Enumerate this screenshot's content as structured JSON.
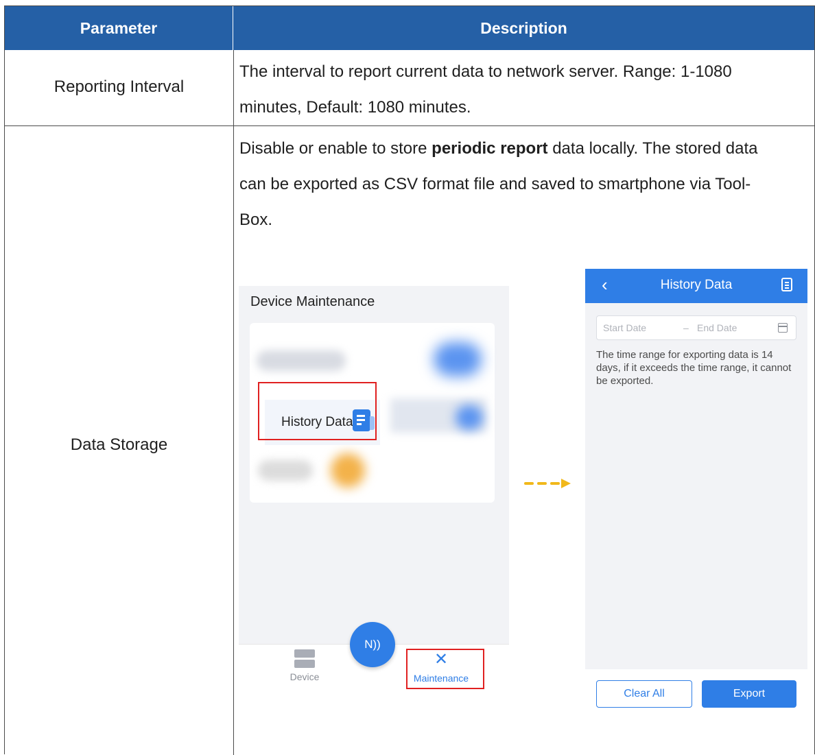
{
  "table": {
    "header": {
      "parameter": "Parameter",
      "description": "Description"
    },
    "rows": [
      {
        "parameter": "Reporting Interval",
        "description_line1": "The interval to report current data to network server. Range: 1-1080",
        "description_line2": "minutes, Default: 1080 minutes."
      },
      {
        "parameter": "Data Storage",
        "description_pre": "Disable or enable to store ",
        "description_bold": "periodic report",
        "description_post1": " data locally. The stored data",
        "description_line2": "can be exported as CSV format file and saved to smartphone via Tool-",
        "description_line3": "Box."
      }
    ]
  },
  "phone_left": {
    "title": "Device Maintenance",
    "history_item": "History Data",
    "nav": {
      "device": "Device",
      "maintenance": "Maintenance"
    },
    "nfc_symbol": "N))",
    "icons": {
      "history": "document-icon",
      "device": "server-icon",
      "maintenance": "tools-icon",
      "nfc": "nfc-icon"
    }
  },
  "phone_right": {
    "title": "History Data",
    "start_placeholder": "Start Date",
    "date_separator": "–",
    "end_placeholder": "End Date",
    "note": "The time range for exporting data is 14 days, if it exceeds the time range, it cannot be exported.",
    "clear_button": "Clear All",
    "export_button": "Export"
  },
  "colors": {
    "header_bg": "#2560a6",
    "app_blue": "#2f7ee6",
    "highlight_red": "#e02020",
    "arrow_yellow": "#f1b81b"
  }
}
